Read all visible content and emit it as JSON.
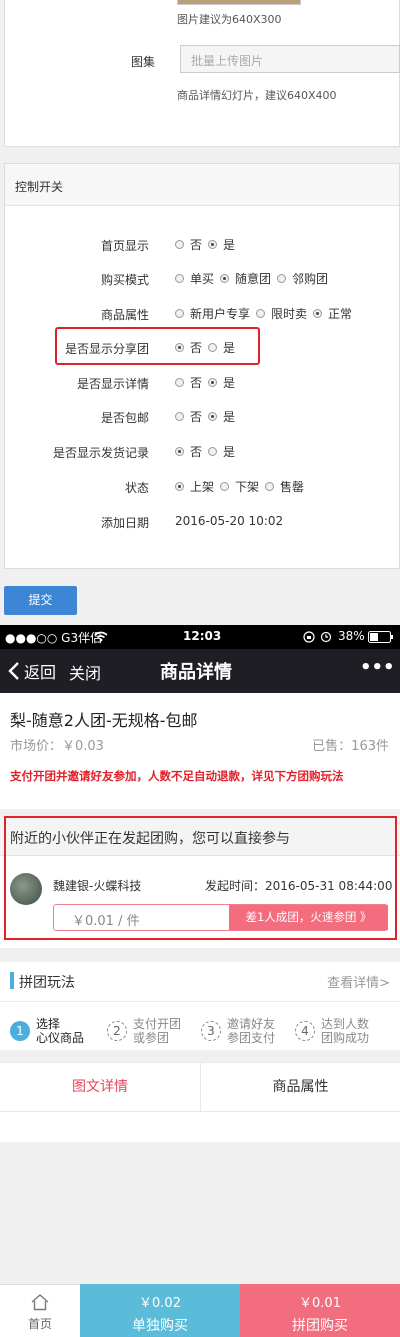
{
  "admin": {
    "image_hint": "图片建议为640X300",
    "gallery": {
      "label": "图集",
      "placeholder": "批量上传图片",
      "hint": "商品详情幻灯片，建议640X400"
    },
    "control_title": "控制开关",
    "rows": [
      {
        "label": "首页显示",
        "options": [
          "否",
          "是"
        ],
        "selected": 1
      },
      {
        "label": "购买模式",
        "options": [
          "单买",
          "随意团",
          "邻购团"
        ],
        "selected": 1
      },
      {
        "label": "商品属性",
        "options": [
          "新用户专享",
          "限时卖",
          "正常"
        ],
        "selected": 2
      },
      {
        "label": "是否显示分享团",
        "options": [
          "否",
          "是"
        ],
        "selected": 0
      },
      {
        "label": "是否显示详情",
        "options": [
          "否",
          "是"
        ],
        "selected": 1
      },
      {
        "label": "是否包邮",
        "options": [
          "否",
          "是"
        ],
        "selected": 1
      },
      {
        "label": "是否显示发货记录",
        "options": [
          "否",
          "是"
        ],
        "selected": 0
      },
      {
        "label": "状态",
        "options": [
          "上架",
          "下架",
          "售罄"
        ],
        "selected": 0
      }
    ],
    "add_date": {
      "label": "添加日期",
      "value": "2016-05-20 10:02"
    },
    "submit_label": "提交",
    "highlight_color": "#e0222a",
    "submit_color": "#3d86d6"
  },
  "phone": {
    "status": {
      "carrier": "●●●○○ G3伴侣",
      "time": "12:03",
      "battery": "38%"
    },
    "nav": {
      "back": "返回",
      "close": "关闭",
      "title": "商品详情",
      "more": "•••"
    },
    "product": {
      "title": "梨-随意2人团-无规格-包邮",
      "market_price": "市场价：￥0.03",
      "sold": "已售：163件",
      "notice": "支付开团并邀请好友参加，人数不足自动退款，详见下方团购玩法"
    },
    "nearby": {
      "header": "附近的小伙伴正在发起团购，您可以直接参与",
      "user": "魏建银-火蝶科技",
      "time": "发起时间：2016-05-31 08:44:00",
      "price": "￥0.01 / 件",
      "join": "差1人成团，火速参团 》"
    },
    "play": {
      "title": "拼团玩法",
      "details": "查看详情>",
      "steps": [
        {
          "num": "1",
          "line1": "选择",
          "line2": "心仪商品"
        },
        {
          "num": "2",
          "line1": "支付开团",
          "line2": "或参团"
        },
        {
          "num": "3",
          "line1": "邀请好友",
          "line2": "参团支付"
        },
        {
          "num": "4",
          "line1": "达到人数",
          "line2": "团购成功"
        }
      ]
    },
    "tabs": [
      "图文详情",
      "商品属性"
    ],
    "bottom": {
      "home": "首页",
      "single_price": "￥0.02",
      "single_label": "单独购买",
      "group_price": "￥0.01",
      "group_label": "拼团购买"
    },
    "colors": {
      "accent": "#e8435c",
      "single_bg": "#5bbcd9",
      "group_bg": "#f26d7d",
      "step_active": "#4aaee0"
    }
  }
}
